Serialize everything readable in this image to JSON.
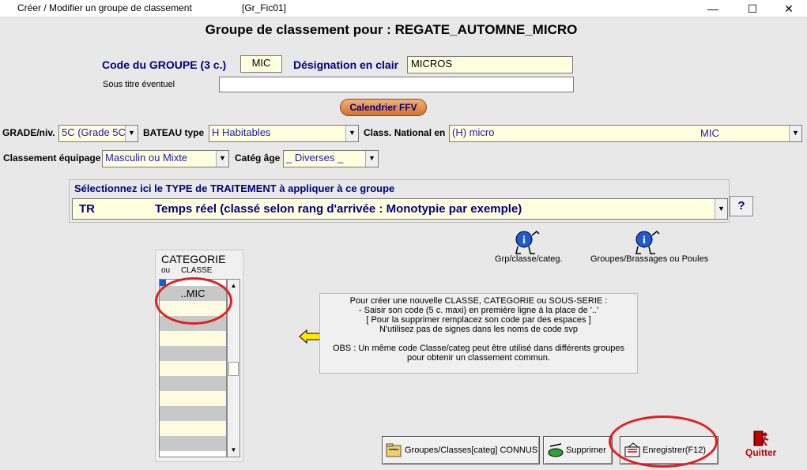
{
  "window": {
    "title": "Créer / Modifier un groupe de classement",
    "form_id": "[Gr_Fic01]",
    "minimize": "—",
    "maximize": "☐",
    "close": "✕"
  },
  "heading": "Groupe de classement pour : REGATE_AUTOMNE_MICRO",
  "code_groupe": {
    "label": "Code du GROUPE (3 c.)",
    "value": "MIC"
  },
  "designation": {
    "label": "Désignation en clair",
    "value": "MICROS"
  },
  "sous_titre": {
    "label": "Sous titre éventuel",
    "value": ""
  },
  "calendrier_button": "Calendrier FFV",
  "grade": {
    "label": "GRADE/niv.",
    "value": "5C (Grade 5C"
  },
  "bateau_type": {
    "label": "BATEAU type",
    "value": "H  Habitables"
  },
  "class_national": {
    "label": "Class. National en",
    "value": "(H)  micro",
    "code": "MIC"
  },
  "classement_equipage": {
    "label": "Classement équipage",
    "value": "Masculin ou Mixte"
  },
  "categ_age": {
    "label": "Catég âge",
    "value": "_ Diverses _"
  },
  "traitement": {
    "label": "Sélectionnez ici le TYPE de TRAITEMENT à appliquer à ce groupe",
    "code": "TR",
    "description": "Temps réel (classé selon rang d'arrivée : Monotypie par exemple)",
    "help_button": "?"
  },
  "icons": {
    "grp_classe_categ": {
      "icon": "info-person-icon",
      "caption": "Grp/classe/categ."
    },
    "groupes_brassages": {
      "icon": "info-person-icon",
      "caption": "Groupes/Brassages ou Poules"
    }
  },
  "categorie_list": {
    "title": "CATEGORIE",
    "subtitle_a": "ou",
    "subtitle_b": "CLASSE",
    "items": [
      "..MIC",
      "",
      "",
      "",
      "",
      "",
      "",
      "",
      "",
      "",
      ""
    ]
  },
  "info_text": {
    "lines": [
      "Pour créer une nouvelle CLASSE, CATEGORIE ou  SOUS-SERIE  :",
      "- Saisir son code (5 c. maxi) en première ligne à la place de  '..'",
      "[ Pour la supprimer  remplacez son code par des espaces ]",
      "N'utilisez  pas  de  signes  dans  les  noms  de  code  svp",
      "",
      "OBS : Un même code Classe/categ peut être utilisé dans différents groupes",
      "pour obtenir un classement commun."
    ]
  },
  "buttons": {
    "connus": "Groupes/Classes[categ] CONNUS",
    "supprimer": "Supprimer",
    "enregistrer": "Enregistrer(F12)",
    "quitter": "Quitter"
  }
}
